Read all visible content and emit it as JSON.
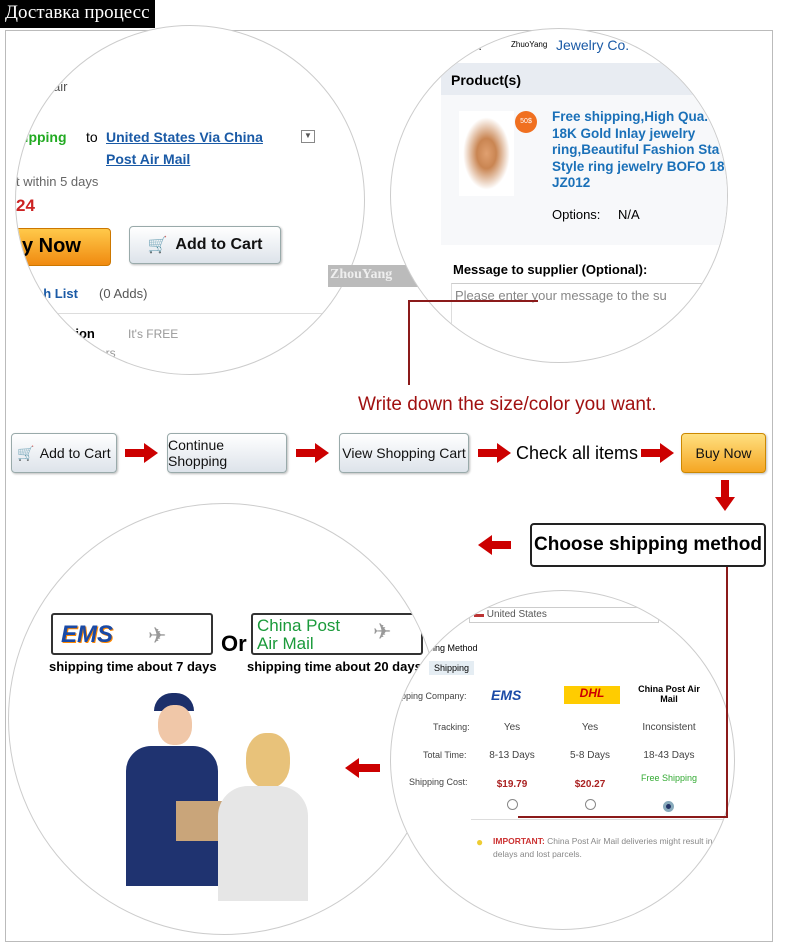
{
  "title": "Доставка процесс",
  "circle1": {
    "air": "air",
    "shipping": "hipping",
    "to": "to",
    "ship_link_1": "United States Via China",
    "ship_link_2": "Post Air Mail",
    "within": "t within 5 days",
    "price": "24",
    "buy_now": "y Now",
    "add_to_cart": "Add to Cart",
    "wish_list": "sh List",
    "adds": "(0 Adds)",
    "protection": "tion",
    "free": "It's FREE",
    "ers": "ers"
  },
  "watermark": "ZhouYang",
  "circle2": {
    "supplier_prefix": "lier:",
    "supplier_brand": "ZhuoYang",
    "supplier_name": "Jewelry Co.",
    "products_header": "Product(s)",
    "badge": "50$",
    "product_title": "Free shipping,High Qua. 18K Gold Inlay jewelry ring,Beautiful Fashion Sta Style ring jewelry BOFO 18 JZ012",
    "options_label": "Options:",
    "options_value": "N/A",
    "message_label": "Message to supplier (Optional):",
    "message_placeholder": "Please enter your message to the su"
  },
  "instruction": "Write down the size/color you want.",
  "flow": {
    "add_to_cart": "Add to Cart",
    "continue_shopping": "Continue Shopping",
    "view_cart": "View Shopping Cart",
    "check_items": "Check all items",
    "buy_now": "Buy Now",
    "choose_shipping": "Choose shipping method"
  },
  "circle3": {
    "ems_logo": "EMS",
    "or": "Or",
    "china_post_logo_1": "China Post",
    "china_post_logo_2": "Air Mail",
    "ems_time": "shipping time about 7 days",
    "china_post_time": "shipping time about 20 days"
  },
  "circle4": {
    "country": "United States",
    "method_label": "pping Method",
    "shipping_tab": "Shipping",
    "company_label": "pping Company:",
    "tracking_label": "Tracking:",
    "total_time_label": "Total Time:",
    "cost_label": "Shipping Cost:",
    "columns": [
      {
        "name": "EMS",
        "tracking": "Yes",
        "time": "8-13 Days",
        "cost": "$19.79",
        "selected": false
      },
      {
        "name": "DHL",
        "tracking": "Yes",
        "time": "5-8 Days",
        "cost": "$20.27",
        "selected": false
      },
      {
        "name": "China Post Air Mail",
        "tracking": "Inconsistent",
        "time": "18-43 Days",
        "cost": "Free Shipping",
        "selected": true
      }
    ],
    "important_label": "IMPORTANT:",
    "important_text": "China Post Air Mail deliveries might result in delays and lost parcels."
  },
  "colors": {
    "arrow": "#cc0000",
    "link": "#1a5aa6",
    "buy_now": "#f5a623",
    "instruction": "#a01010"
  }
}
